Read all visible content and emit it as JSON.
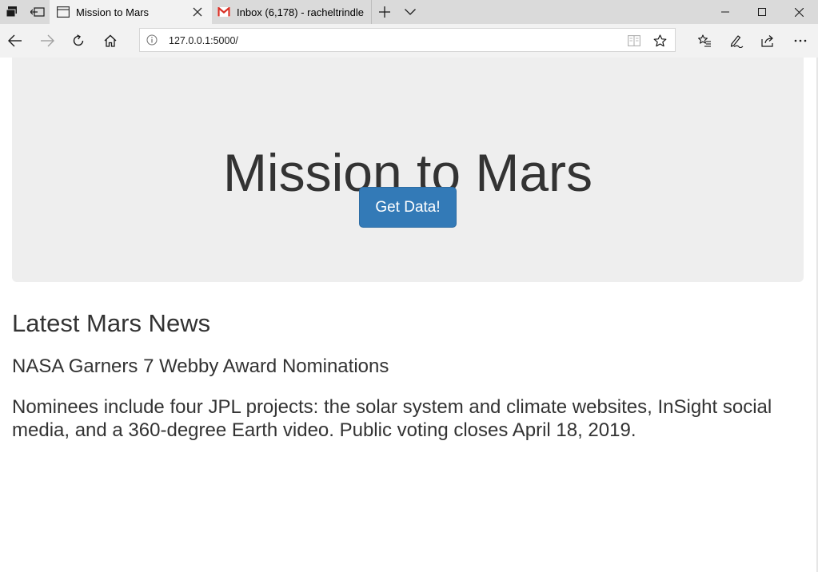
{
  "browser": {
    "tabs": [
      {
        "title": "Mission to Mars",
        "icon": "page-icon",
        "active": true
      },
      {
        "title": "Inbox (6,178) - racheltrindle",
        "icon": "gmail-icon",
        "active": false
      }
    ],
    "address_bar": {
      "url": "127.0.0.1:5000/"
    },
    "colors": {
      "tabstrip": "#dadada",
      "toolbar": "#f2f2f2"
    }
  },
  "page": {
    "jumbotron": {
      "title": "Mission to Mars",
      "button_label": "Get Data!"
    },
    "news": {
      "section_heading": "Latest Mars News",
      "headline": "NASA Garners 7 Webby Award Nominations",
      "paragraph": "Nominees include four JPL projects: the solar system and climate websites, InSight social media, and a 360-degree Earth video. Public voting closes April 18, 2019."
    },
    "colors": {
      "button": "#337ab7",
      "jumbotron": "#eeeeee",
      "text": "#333333"
    }
  }
}
